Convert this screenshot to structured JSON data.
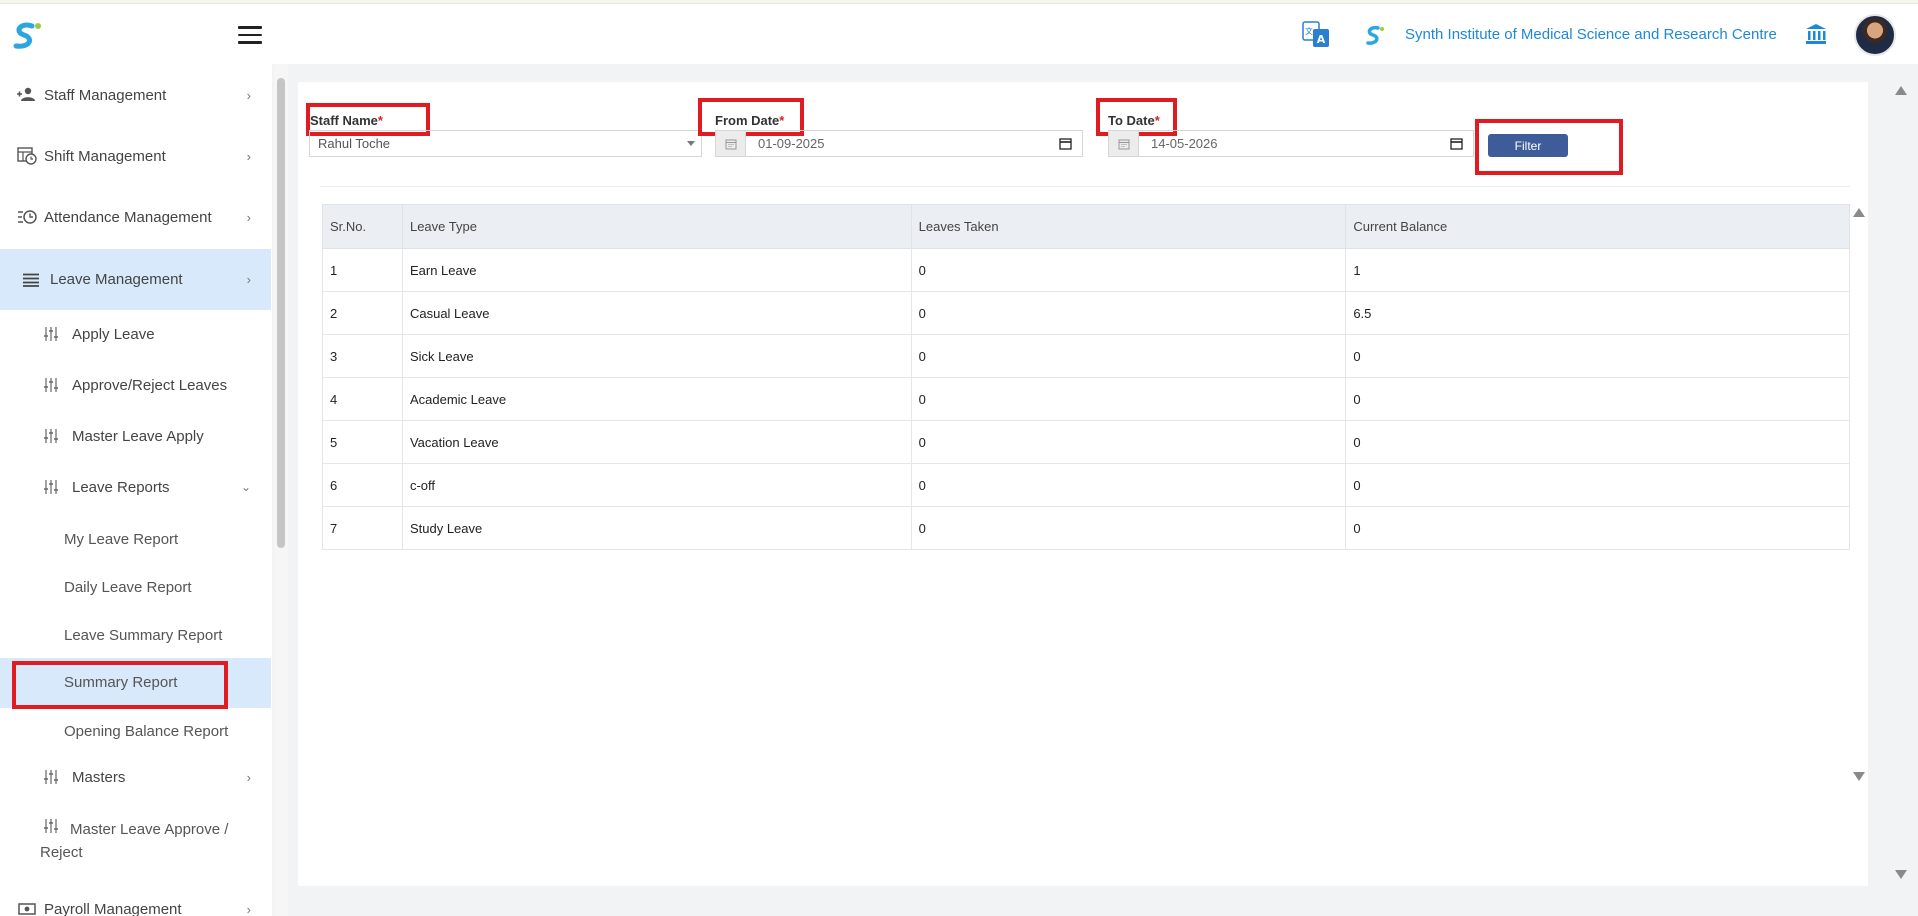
{
  "header": {
    "institute_name": "Synth Institute of Medical Science and Research Centre",
    "icons": [
      "app-logo-icon",
      "hamburger-icon",
      "translate-icon",
      "institute-logo-icon",
      "bank-icon",
      "avatar"
    ]
  },
  "sidebar": {
    "items": [
      {
        "label": "Staff Management",
        "icon": "staff-icon"
      },
      {
        "label": "Shift Management",
        "icon": "shift-icon"
      },
      {
        "label": "Attendance Management",
        "icon": "attendance-icon"
      },
      {
        "label": "Leave Management",
        "icon": "list-icon"
      }
    ],
    "leave_sub": [
      {
        "label": "Apply Leave"
      },
      {
        "label": "Approve/Reject Leaves"
      },
      {
        "label": "Master Leave Apply"
      },
      {
        "label": "Leave Reports"
      }
    ],
    "reports_sub": [
      {
        "label": "My Leave Report"
      },
      {
        "label": "Daily Leave Report"
      },
      {
        "label": "Leave Summary Report"
      },
      {
        "label": "Summary Report"
      },
      {
        "label": "Opening Balance Report"
      }
    ],
    "masters": {
      "label": "Masters"
    },
    "master_approve": {
      "label": "Master Leave Approve / Reject"
    },
    "payroll": {
      "label": "Payroll Management"
    }
  },
  "filters": {
    "staff_name_label": "Staff Name",
    "staff_name_value": "Rahul Toche",
    "from_date_label": "From Date",
    "from_date_value": "01-09-2025",
    "to_date_label": "To Date",
    "to_date_value": "14-05-2026",
    "required_mark": "*",
    "filter_button": "Filter"
  },
  "table": {
    "headers": [
      "Sr.No.",
      "Leave Type",
      "Leaves Taken",
      "Current Balance"
    ],
    "rows": [
      [
        "1",
        "Earn Leave",
        "0",
        "1"
      ],
      [
        "2",
        "Casual Leave",
        "0",
        "6.5"
      ],
      [
        "3",
        "Sick Leave",
        "0",
        "0"
      ],
      [
        "4",
        "Academic Leave",
        "0",
        "0"
      ],
      [
        "5",
        "Vacation Leave",
        "0",
        "0"
      ],
      [
        "6",
        "c-off",
        "0",
        "0"
      ],
      [
        "7",
        "Study Leave",
        "0",
        "0"
      ]
    ]
  },
  "colors": {
    "accent": "#1e88d8",
    "active_bg": "#d7e9fb",
    "button": "#3f5c9a",
    "highlight": "#e11b22"
  }
}
